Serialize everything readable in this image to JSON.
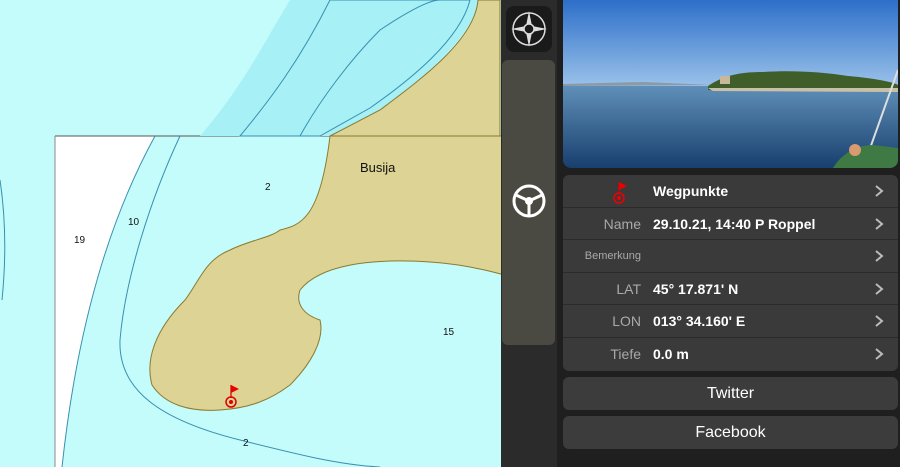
{
  "map": {
    "place_name": "Busija",
    "depth_soundings": [
      "2",
      "10",
      "19",
      "2",
      "15"
    ],
    "colors": {
      "deep_water": "#c4fbfb",
      "shallow_water": "#a6f0f6",
      "contour_band": "#8ee4f0",
      "land": "#dcd394",
      "white_area": "#ffffff"
    }
  },
  "toolbar": {
    "compass_icon": "compass-rose-icon",
    "helm_icon": "ship-wheel-icon"
  },
  "panel": {
    "photo_icon": "waypoint-photo",
    "rows": [
      {
        "label": "",
        "value": "Wegpunkte",
        "icon": "waypoint-flag-icon"
      },
      {
        "label": "Name",
        "value": "29.10.21, 14:40 P Roppel"
      },
      {
        "label": "Bemerkung",
        "value": ""
      },
      {
        "label": "LAT",
        "value": "45° 17.871' N"
      },
      {
        "label": "LON",
        "value": "013° 34.160' E"
      },
      {
        "label": "Tiefe",
        "value": "0.0 m"
      }
    ],
    "twitter_label": "Twitter",
    "facebook_label": "Facebook"
  }
}
